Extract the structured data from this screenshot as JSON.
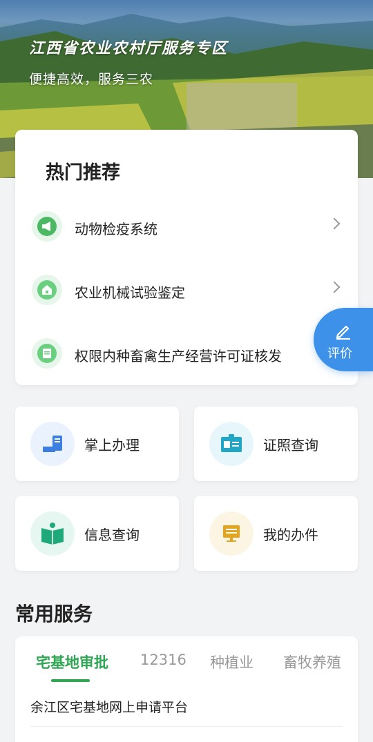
{
  "banner": {
    "title": "江西省农业农村厅服务专区",
    "subtitle": "便捷高效，服务三农"
  },
  "hot": {
    "title": "热门推荐",
    "items": [
      {
        "label": "动物检疫系统",
        "icon": "megaphone-icon"
      },
      {
        "label": "农业机械试验鉴定",
        "icon": "house-icon"
      },
      {
        "label": "权限内种畜禽生产经营许可证核发",
        "icon": "document-icon"
      }
    ]
  },
  "eval_button": {
    "label": "评价",
    "icon": "pencil-icon"
  },
  "tiles": [
    {
      "label": "掌上办理",
      "icon": "phone-hand-icon",
      "color": "#3d7fe0"
    },
    {
      "label": "证照查询",
      "icon": "id-card-icon",
      "color": "#22a6c6"
    },
    {
      "label": "信息查询",
      "icon": "open-book-icon",
      "color": "#1fa87a"
    },
    {
      "label": "我的办件",
      "icon": "monitor-icon",
      "color": "#e3a51e"
    }
  ],
  "common_services": {
    "title": "常用服务",
    "tabs": [
      "宅基地审批",
      "12316",
      "种植业",
      "畜牧养殖"
    ],
    "active_tab": "宅基地审批",
    "items": [
      "余江区宅基地网上申请平台"
    ]
  },
  "colors": {
    "accent": "#2fa653",
    "eval": "#3d91e8"
  }
}
